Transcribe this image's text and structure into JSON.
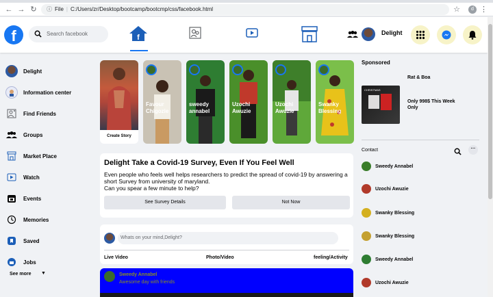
{
  "browser": {
    "url_prefix": "File",
    "url": "C:/Users/zr/Desktop/bootcamp/bootcmp/css/facebook.html",
    "profile_initial": "d"
  },
  "header": {
    "logo": "f",
    "search_placeholder": "Search facebook",
    "user_name": "Delight"
  },
  "sidebar": {
    "items": [
      {
        "label": "Delight",
        "icon": "avatar-icon"
      },
      {
        "label": "Information center",
        "icon": "info-icon"
      },
      {
        "label": "Find Friends",
        "icon": "friends-icon"
      },
      {
        "label": "Groups",
        "icon": "groups-icon"
      },
      {
        "label": "Market Place",
        "icon": "store-icon"
      },
      {
        "label": "Watch",
        "icon": "watch-icon"
      },
      {
        "label": "Events",
        "icon": "calendar-icon"
      },
      {
        "label": "Memories",
        "icon": "clock-icon"
      },
      {
        "label": "Saved",
        "icon": "bookmark-icon"
      },
      {
        "label": "Jobs",
        "icon": "briefcase-icon"
      }
    ],
    "see_more": "See more"
  },
  "stories": {
    "create_label": "Create Story",
    "items": [
      {
        "name": "Favour Chigozie",
        "bg": "#c9c2b4"
      },
      {
        "name": "sweedy annabel",
        "bg": "#2e7d32"
      },
      {
        "name": "Uzochi Awuzie",
        "bg": "#4a8f2a"
      },
      {
        "name": "Uzochi Awuzie",
        "bg": "#5fa83a"
      },
      {
        "name": "Swanky Blessing",
        "bg": "#7bbf4a"
      }
    ]
  },
  "survey": {
    "title": "Delight Take a Covid-19 Survey, Even If You Feel Well",
    "body": "Even people who feels well helps researchers to predict the spread of covid-19 by answering a short Survey from university of maryland.",
    "question": "Can you spear a few minute to help?",
    "see_details": "See Survey Details",
    "not_now": "Not Now"
  },
  "composer": {
    "placeholder": "Whats on your mind,Delight?",
    "live": "Live Video",
    "photo": "Photo/Video",
    "feeling": "feeling/Activity"
  },
  "post": {
    "author": "Sweedy Annabel",
    "subtitle": "Awesome day with friends"
  },
  "right": {
    "sponsored": "Sponsored",
    "ad_title": "Rat & Boa",
    "ad_desc": "Only 998$ This Week Only",
    "ad_img_text": "CHRISTMAS",
    "contact_label": "Contact",
    "contacts": [
      {
        "name": "Sweedy Annabel",
        "color": "#3a7d2a"
      },
      {
        "name": "Uzochi Awuzie",
        "color": "#b13a2a"
      },
      {
        "name": "Swanky Blessing",
        "color": "#d4b020"
      },
      {
        "name": "Swanky Blessing",
        "color": "#c4a030"
      },
      {
        "name": "Sweedy Annabel",
        "color": "#2e7d32"
      },
      {
        "name": "Uzochi Awuzie",
        "color": "#b13a2a"
      }
    ]
  },
  "colors": {
    "brand": "#1877f2",
    "post_bg": "#0000ff"
  }
}
